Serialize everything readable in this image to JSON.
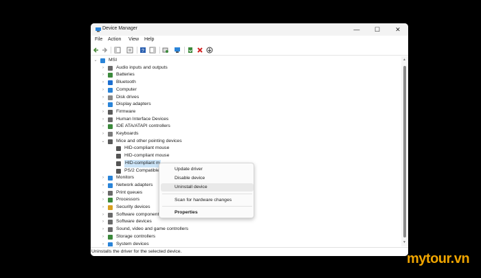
{
  "window": {
    "title": "Device Manager",
    "title_icon": "device-manager-icon",
    "controls": {
      "minimize": "—",
      "maximize": "☐",
      "close": "✕"
    }
  },
  "menu": [
    "File",
    "Action",
    "View",
    "Help"
  ],
  "toolbar": {
    "icons": [
      "back-arrow-icon",
      "forward-arrow-icon",
      "show-hide-tree-icon",
      "properties-icon",
      "help-icon",
      "action-pane-icon",
      "scan-hardware-icon",
      "monitor-icon",
      "update-driver-icon",
      "uninstall-icon",
      "download-icon"
    ]
  },
  "tree": {
    "root": "MSI",
    "categories": [
      {
        "label": "Audio inputs and outputs",
        "icon": "speaker-icon",
        "color": "#6a6a6a"
      },
      {
        "label": "Batteries",
        "icon": "battery-icon",
        "color": "#3c8a3c"
      },
      {
        "label": "Bluetooth",
        "icon": "bluetooth-icon",
        "color": "#1c6fd1"
      },
      {
        "label": "Computer",
        "icon": "computer-icon",
        "color": "#2a84d8"
      },
      {
        "label": "Disk drives",
        "icon": "disk-icon",
        "color": "#8a8a8a"
      },
      {
        "label": "Display adapters",
        "icon": "display-adapter-icon",
        "color": "#2a84d8"
      },
      {
        "label": "Firmware",
        "icon": "firmware-icon",
        "color": "#5a5a5a"
      },
      {
        "label": "Human Interface Devices",
        "icon": "hid-icon",
        "color": "#6a6a6a"
      },
      {
        "label": "IDE ATA/ATAPI controllers",
        "icon": "ide-icon",
        "color": "#3c8a3c"
      },
      {
        "label": "Keyboards",
        "icon": "keyboard-icon",
        "color": "#7a7a7a"
      },
      {
        "label": "Mice and other pointing devices",
        "icon": "mouse-icon",
        "color": "#5a5a5a",
        "expanded": true
      }
    ],
    "mice_children": [
      "HID-compliant mouse",
      "HID-compliant mouse",
      "HID-compliant m",
      "PS/2 Compatible"
    ],
    "categories_after": [
      {
        "label": "Monitors",
        "icon": "monitor-icon",
        "color": "#2a84d8"
      },
      {
        "label": "Network adapters",
        "icon": "network-icon",
        "color": "#2a84d8"
      },
      {
        "label": "Print queues",
        "icon": "printer-icon",
        "color": "#6a6a6a"
      },
      {
        "label": "Processors",
        "icon": "processor-icon",
        "color": "#3c8a3c"
      },
      {
        "label": "Security devices",
        "icon": "security-icon",
        "color": "#d8a020"
      },
      {
        "label": "Software components",
        "icon": "software-component-icon",
        "color": "#6a6a6a"
      },
      {
        "label": "Software devices",
        "icon": "software-device-icon",
        "color": "#6a6a6a"
      },
      {
        "label": "Sound, video and game controllers",
        "icon": "sound-icon",
        "color": "#6a6a6a"
      },
      {
        "label": "Storage controllers",
        "icon": "storage-icon",
        "color": "#3c8a3c"
      },
      {
        "label": "System devices",
        "icon": "system-icon",
        "color": "#2a84d8"
      }
    ]
  },
  "context_menu": {
    "items": [
      "Update driver",
      "Disable device",
      "Uninstall device",
      "Scan for hardware changes",
      "Properties"
    ],
    "highlighted": "Uninstall device"
  },
  "status": "Uninstalls the driver for the selected device.",
  "watermark": "mytour.vn",
  "colors": {
    "accent": "#f0a500",
    "selection": "#cce4f7"
  }
}
